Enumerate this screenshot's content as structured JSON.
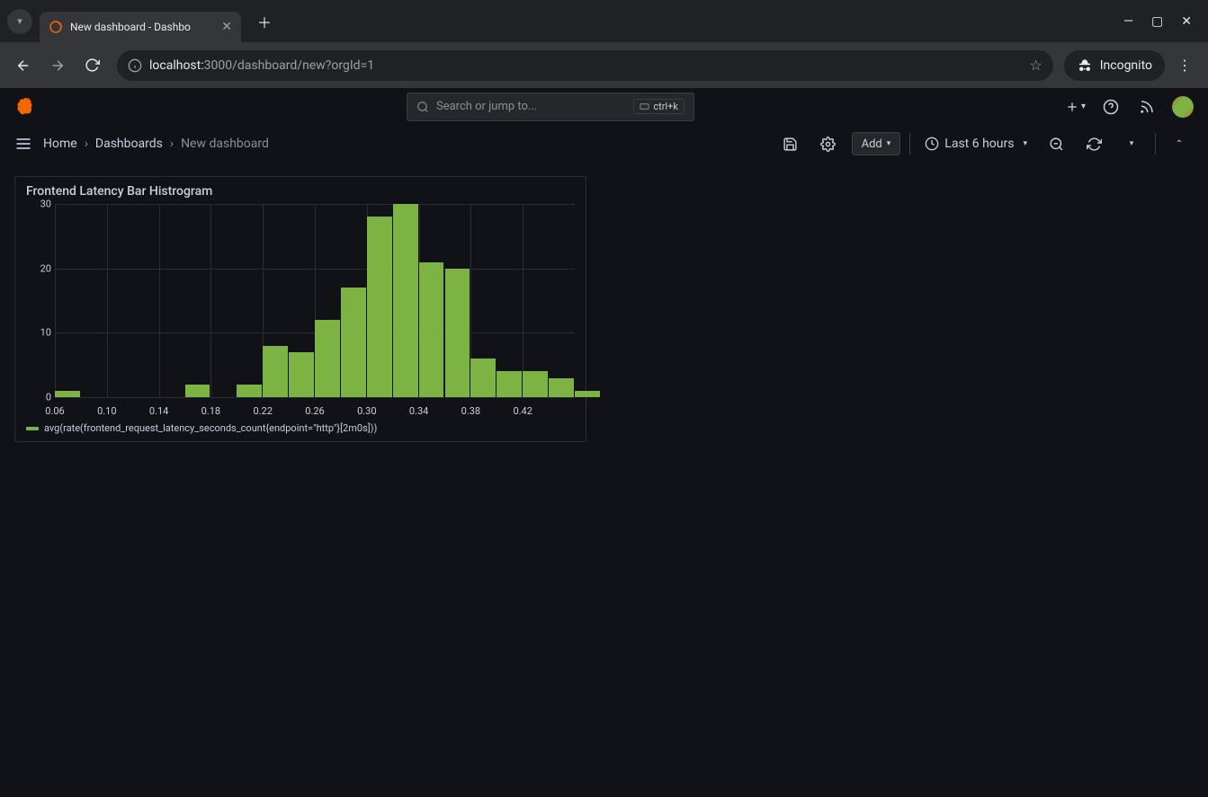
{
  "browser": {
    "tab_title": "New dashboard - Dashbo",
    "url_host": "localhost:",
    "url_path": "3000/dashboard/new?orgId=1",
    "incognito": "Incognito"
  },
  "header": {
    "search_placeholder": "Search or jump to...",
    "kbd": "ctrl+k"
  },
  "breadcrumbs": {
    "home": "Home",
    "dashboards": "Dashboards",
    "current": "New dashboard"
  },
  "toolbar": {
    "add": "Add",
    "time_range": "Last 6 hours"
  },
  "panel": {
    "title": "Frontend Latency Bar Histrogram",
    "legend": "avg(rate(frontend_request_latency_seconds_count{endpoint=\"http\"}[2m0s]))"
  },
  "chart_data": {
    "type": "bar",
    "title": "Frontend Latency Bar Histrogram",
    "xlabel": "",
    "ylabel": "",
    "ylim": [
      0,
      30
    ],
    "xticks": [
      "0.06",
      "0.10",
      "0.14",
      "0.18",
      "0.22",
      "0.26",
      "0.30",
      "0.34",
      "0.38",
      "0.42"
    ],
    "yticks": [
      0,
      10,
      20,
      30
    ],
    "categories": [
      "0.06",
      "0.08",
      "0.10",
      "0.12",
      "0.14",
      "0.16",
      "0.18",
      "0.20",
      "0.22",
      "0.24",
      "0.26",
      "0.28",
      "0.30",
      "0.32",
      "0.34",
      "0.36",
      "0.38",
      "0.40",
      "0.42",
      "0.44"
    ],
    "values": [
      1,
      0,
      0,
      0,
      0,
      2,
      0,
      2,
      8,
      7,
      12,
      17,
      28,
      30,
      21,
      20,
      6,
      4,
      4,
      3,
      1
    ],
    "series_name": "avg(rate(frontend_request_latency_seconds_count{endpoint=\"http\"}[2m0s]))",
    "bar_color": "#7cb342"
  }
}
